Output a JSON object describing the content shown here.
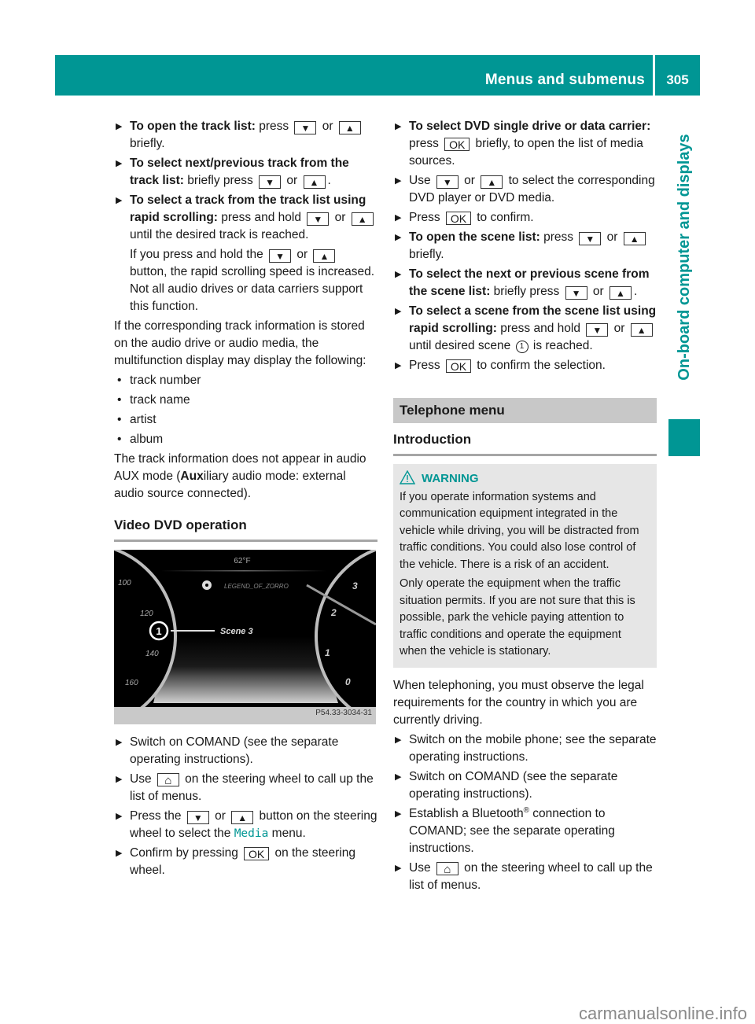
{
  "header": {
    "title": "Menus and submenus",
    "page_number": "305",
    "side_tab": "On-board computer and displays"
  },
  "colors": {
    "accent": "#009694",
    "section_bg": "#c8c8c8",
    "warning_bg": "#e6e6e6"
  },
  "icons": {
    "down": "▼",
    "up": "▲",
    "ok": "OK",
    "home": "⌂",
    "step_arrow": "▶",
    "bullet": "•",
    "callout_1": "1"
  },
  "left_column": {
    "steps_top": [
      {
        "bold": "To open the track list:",
        "text_a": " press ",
        "text_b": " or ",
        "text_c": " briefly."
      },
      {
        "bold": "To select next/previous track from the track list:",
        "text_a": " briefly press ",
        "text_b": " or ",
        "text_c": "."
      },
      {
        "bold": "To select a track from the track list using rapid scrolling:",
        "text_a": " press and hold ",
        "text_b": " or ",
        "text_c": " until the desired track is reached."
      }
    ],
    "rapid_note": {
      "a": "If you press and hold the ",
      "b": " or ",
      "c": " button, the rapid scrolling speed is increased. Not all audio drives or data carriers support this function."
    },
    "track_info_intro": "If the corresponding track information is stored on the audio drive or audio media, the multifunction display may display the following:",
    "track_info_items": [
      "track number",
      "track name",
      "artist",
      "album"
    ],
    "aux_note": {
      "a": "The track information does not appear in audio AUX mode (",
      "bold": "Aux",
      "c": "iliary audio mode: external audio source connected)."
    },
    "video_heading": "Video DVD operation",
    "figure": {
      "temperature": "62°F",
      "track_title": "LEGEND_OF_ZORRO",
      "scene_label": "Scene 3",
      "speed_ticks": [
        "100",
        "120",
        "140",
        "160"
      ],
      "rpm_ticks": [
        "3",
        "2",
        "1",
        "0"
      ],
      "code": "P54.33-3034-31"
    },
    "steps_bottom": {
      "s1": "Switch on COMAND (see the separate operating instructions).",
      "s2a": "Use ",
      "s2b": " on the steering wheel to call up the list of menus.",
      "s3a": "Press the ",
      "s3b": " or ",
      "s3c": " button on the steering wheel to select the ",
      "s3media": "Media",
      "s3d": " menu.",
      "s4a": "Confirm by pressing ",
      "s4b": " on the steering wheel."
    }
  },
  "right_column": {
    "dvd_steps": {
      "s1bold": "To select DVD single drive or data carrier:",
      "s1a": " press ",
      "s1b": " briefly, to open the list of media sources.",
      "s2a": "Use ",
      "s2b": " or ",
      "s2c": " to select the corresponding DVD player or DVD media.",
      "s3a": "Press ",
      "s3b": " to confirm.",
      "s4bold": "To open the scene list:",
      "s4a": " press ",
      "s4b": " or ",
      "s4c": " briefly.",
      "s5bold": "To select the next or previous scene from the scene list:",
      "s5a": " briefly press ",
      "s5b": " or ",
      "s5c": ".",
      "s6bold": "To select a scene from the scene list using rapid scrolling:",
      "s6a": " press and hold ",
      "s6b": " or ",
      "s6c": " until desired scene ",
      "s6d": " is reached.",
      "s7a": "Press ",
      "s7b": " to confirm the selection."
    },
    "section_title": "Telephone menu",
    "subsection_title": "Introduction",
    "warning": {
      "label": "WARNING",
      "p1": "If you operate information systems and communication equipment integrated in the vehicle while driving, you will be distracted from traffic conditions. You could also lose control of the vehicle. There is a risk of an accident.",
      "p2": "Only operate the equipment when the traffic situation permits. If you are not sure that this is possible, park the vehicle paying attention to traffic conditions and operate the equipment when the vehicle is stationary."
    },
    "legal_note": "When telephoning, you must observe the legal requirements for the country in which you are currently driving.",
    "phone_steps": {
      "s1": "Switch on the mobile phone; see the separate operating instructions.",
      "s2": "Switch on COMAND (see the separate operating instructions).",
      "s3a": "Establish a Bluetooth",
      "s3reg": "®",
      "s3b": " connection to COMAND; see the separate operating instructions.",
      "s4a": "Use ",
      "s4b": " on the steering wheel to call up the list of menus."
    }
  },
  "footer": {
    "watermark": "carmanualsonline.info"
  }
}
